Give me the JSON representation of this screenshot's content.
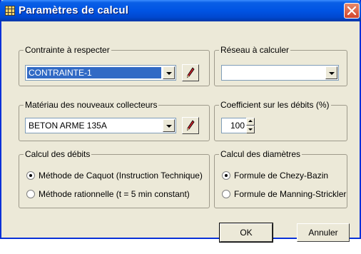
{
  "window": {
    "title": "Paramètres de calcul"
  },
  "contrainte": {
    "legend": "Contrainte à respecter",
    "value": "CONTRAINTE-1"
  },
  "reseau": {
    "legend": "Réseau à calculer",
    "value": ""
  },
  "materiau": {
    "legend": "Matériau des nouveaux collecteurs",
    "value": "BETON ARME 135A"
  },
  "coefficient": {
    "legend": "Coefficient sur les débits (%)",
    "value": "100"
  },
  "debits": {
    "legend": "Calcul des débits",
    "options": [
      {
        "label": "Méthode de Caquot (Instruction Technique)",
        "checked": true
      },
      {
        "label": "Méthode rationnelle (t = 5 min constant)",
        "checked": false
      }
    ]
  },
  "diametres": {
    "legend": "Calcul des diamètres",
    "options": [
      {
        "label": "Formule de Chezy-Bazin",
        "checked": true
      },
      {
        "label": "Formule de Manning-Strickler",
        "checked": false
      }
    ]
  },
  "buttons": {
    "ok": "OK",
    "cancel": "Annuler"
  },
  "colors": {
    "titlebar": "#0054e3",
    "dialog": "#ece9d8",
    "selection": "#316ac5",
    "close": "#d2452c"
  },
  "icons": {
    "app": "grid-icon",
    "close": "close-icon",
    "edit": "pencil-icon"
  }
}
